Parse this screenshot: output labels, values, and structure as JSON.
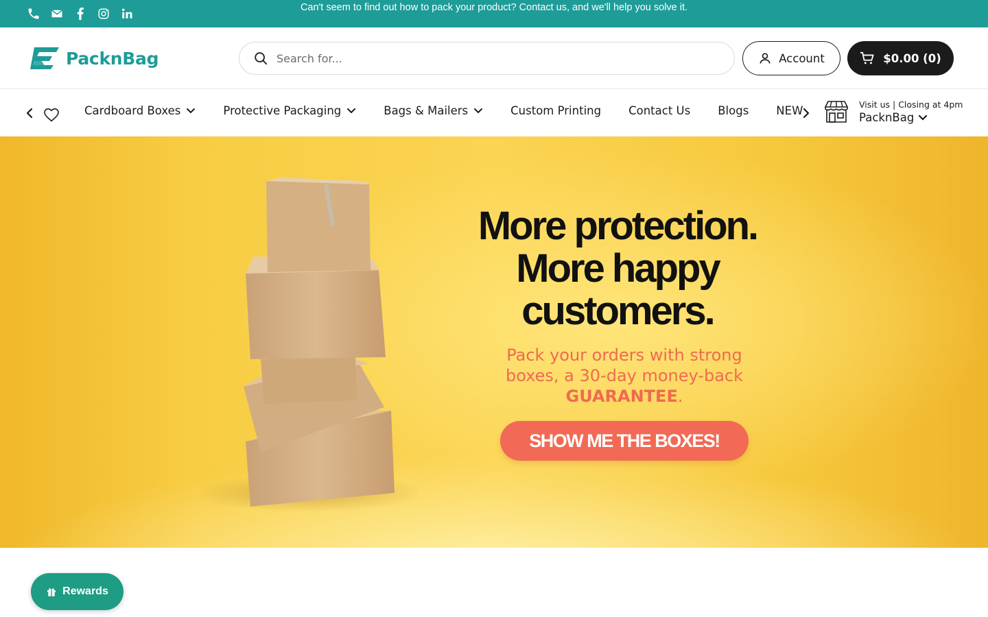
{
  "announcement": {
    "message": "Can't seem to find out how to pack your product? Contact us, and we'll help you solve it.",
    "socials": [
      "phone-icon",
      "email-icon",
      "facebook-icon",
      "instagram-icon",
      "linkedin-icon"
    ]
  },
  "header": {
    "logo_text": "PacknBag",
    "search_placeholder": "Search for...",
    "account_label": "Account",
    "cart_label": "$0.00 (0)"
  },
  "nav": {
    "items": [
      {
        "label": "Cardboard Boxes",
        "has_dropdown": true
      },
      {
        "label": "Protective Packaging",
        "has_dropdown": true
      },
      {
        "label": "Bags & Mailers",
        "has_dropdown": true
      },
      {
        "label": "Custom Printing",
        "has_dropdown": false
      },
      {
        "label": "Contact Us",
        "has_dropdown": false
      },
      {
        "label": "Blogs",
        "has_dropdown": false
      },
      {
        "label": "NEW",
        "has_dropdown": false
      }
    ],
    "store_hours": "Visit us | Closing at 4pm",
    "store_name": "PacknBag"
  },
  "hero": {
    "title_line1": "More protection.",
    "title_line2": "More happy",
    "title_line3": "customers.",
    "sub_line1": "Pack your orders with strong",
    "sub_line2": "boxes, a 30-day money-back",
    "sub_guarantee": "GUARANTEE",
    "sub_end": ".",
    "cta_label": "SHOW ME THE BOXES!"
  },
  "rewards_label": "Rewards",
  "colors": {
    "brand_teal": "#1e9c98",
    "hero_yellow": "#fbd452",
    "cta_coral": "#f26a55",
    "cart_dark": "#1b1b1b"
  }
}
